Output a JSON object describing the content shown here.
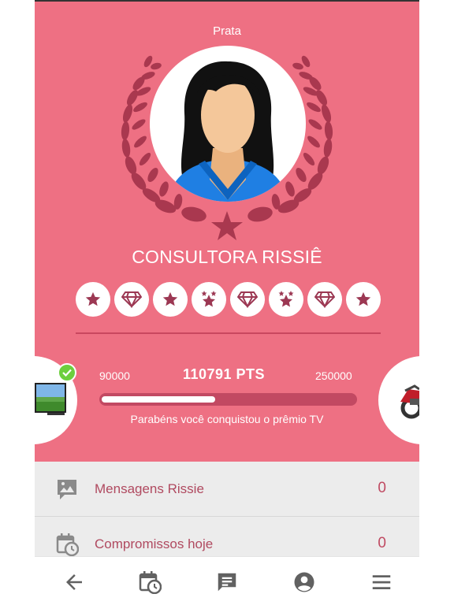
{
  "profile": {
    "level": "Prata",
    "name": "CONSULTORA RISSIÊ"
  },
  "badges": [
    "star",
    "diamond",
    "star",
    "double-star",
    "diamond",
    "double-star",
    "diamond",
    "star"
  ],
  "progress": {
    "min": "90000",
    "max": "250000",
    "points": "110791 PTS",
    "fraction": 0.45,
    "message": "Parabéns você conquistou o prêmio TV"
  },
  "prizes": {
    "left": {
      "icon": "tv-icon",
      "achieved": true
    },
    "right": {
      "icon": "motorcycle-icon",
      "achieved": false
    }
  },
  "list": [
    {
      "icon": "image-message-icon",
      "label": "Mensagens Rissie",
      "count": "0"
    },
    {
      "icon": "calendar-clock-icon",
      "label": "Compromissos hoje",
      "count": "0"
    }
  ],
  "nav": [
    "back-arrow-icon",
    "calendar-clock-icon",
    "chat-icon",
    "account-icon",
    "menu-icon"
  ],
  "colors": {
    "hero": "#ee7083",
    "accent_dark": "#a3344e",
    "list_bg": "#ececec",
    "nav_icon": "#616161"
  }
}
